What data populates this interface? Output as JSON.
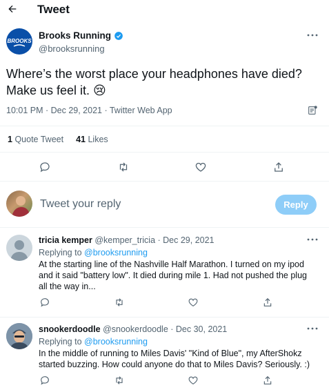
{
  "header": {
    "title": "Tweet"
  },
  "tweet": {
    "author_name": "Brooks Running",
    "author_handle": "@brooksrunning",
    "logo_text": "BROOKS",
    "text": "Where’s the worst place your headphones have died? Make us feel it. 😢",
    "meta": "10:01 PM · Dec 29, 2021 · Twitter Web App",
    "stats": {
      "quotes_count": "1",
      "quotes_label": "Quote Tweet",
      "likes_count": "41",
      "likes_label": "Likes"
    }
  },
  "compose": {
    "placeholder": "Tweet your reply",
    "reply_button": "Reply"
  },
  "replies": [
    {
      "name": "tricia kemper",
      "handle": "@kemper_tricia",
      "date": "· Dec 29, 2021",
      "replying_prefix": "Replying to",
      "replying_to": "@brooksrunning",
      "text": "At the starting line of the Nashville Half Marathon.  I turned on my ipod and it said \"battery low\".  It died during mile 1.  Had not pushed the plug all the way in..."
    },
    {
      "name": "snookerdoodle",
      "handle": "@snookerdoodle",
      "date": "· Dec 30, 2021",
      "replying_prefix": "Replying to",
      "replying_to": "@brooksrunning",
      "text": "In the middle of running to Miles Davis' \"Kind of Blue\", my AfterShokz started buzzing. How could anyone do that to Miles Davis? Seriously. :)"
    }
  ],
  "colors": {
    "accent": "#1d9bf0",
    "verified": "#1d9bf0",
    "brand_logo": "#0a4fa8",
    "reply_button_disabled": "#8ecdf8"
  }
}
